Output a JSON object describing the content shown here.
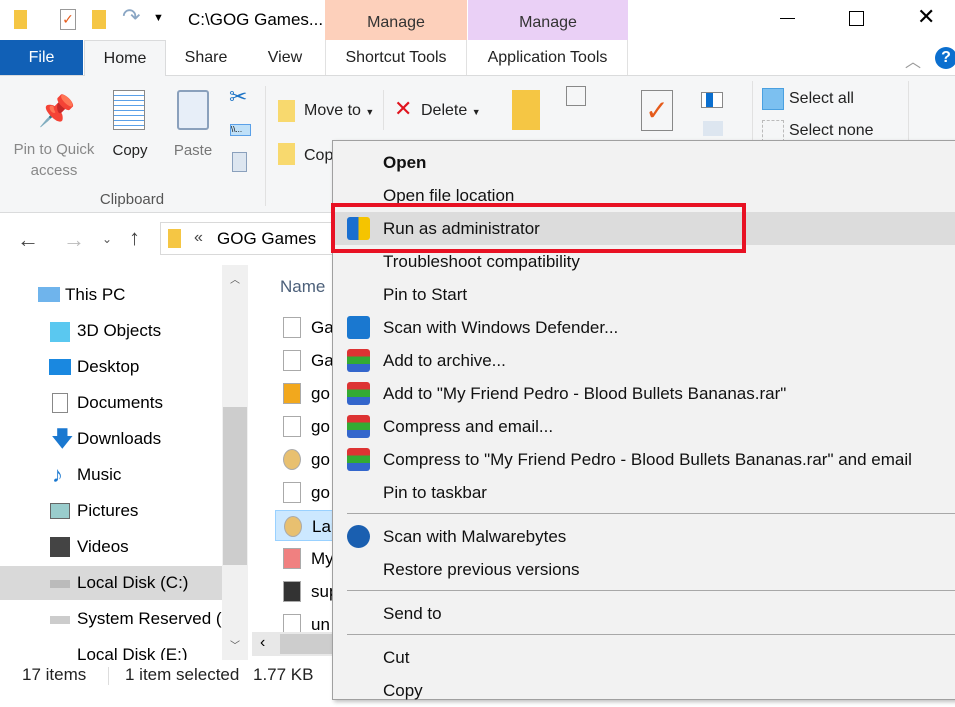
{
  "titlebar": {
    "path": "C:\\GOG Games...",
    "contextual_groups": [
      {
        "label": "Manage",
        "color": "#fdd0bb"
      },
      {
        "label": "Manage",
        "color": "#ead0f6"
      }
    ],
    "controls": [
      "minimize-icon",
      "maximize-icon",
      "close-icon"
    ]
  },
  "tabs": [
    {
      "label": "File"
    },
    {
      "label": "Home"
    },
    {
      "label": "Share"
    },
    {
      "label": "View"
    },
    {
      "label": "Shortcut Tools"
    },
    {
      "label": "Application Tools"
    }
  ],
  "ribbon": {
    "pin": "Pin to Quick",
    "pin2": "access",
    "copy": "Copy",
    "paste": "Paste",
    "clipboard": "Clipboard",
    "move_to": "Move to",
    "delete": "Delete",
    "copy_to": "Copy",
    "select_all": "Select all",
    "select_none": "Select none"
  },
  "address": {
    "crumb_sep": "«",
    "folder": "GOG Games"
  },
  "nav": [
    {
      "label": "This PC"
    },
    {
      "label": "3D Objects"
    },
    {
      "label": "Desktop"
    },
    {
      "label": "Documents"
    },
    {
      "label": "Downloads"
    },
    {
      "label": "Music"
    },
    {
      "label": "Pictures"
    },
    {
      "label": "Videos"
    },
    {
      "label": "Local Disk (C:)"
    },
    {
      "label": "System Reserved ("
    },
    {
      "label": "Local Disk (E:)"
    }
  ],
  "files": {
    "header": "Name",
    "items": [
      {
        "label": "Ga"
      },
      {
        "label": "Ga"
      },
      {
        "label": "go"
      },
      {
        "label": "go"
      },
      {
        "label": "go"
      },
      {
        "label": "go"
      },
      {
        "label": "Lau"
      },
      {
        "label": "My"
      },
      {
        "label": "sup"
      },
      {
        "label": "un"
      }
    ]
  },
  "menu": {
    "items": [
      {
        "label": "Open"
      },
      {
        "label": "Open file location"
      },
      {
        "label": "Run as administrator"
      },
      {
        "label": "Troubleshoot compatibility"
      },
      {
        "label": "Pin to Start"
      },
      {
        "label": "Scan with Windows Defender..."
      },
      {
        "label": "Add to archive..."
      },
      {
        "label": "Add to \"My Friend Pedro - Blood Bullets Bananas.rar\""
      },
      {
        "label": "Compress and email..."
      },
      {
        "label": "Compress to \"My Friend Pedro - Blood Bullets Bananas.rar\" and email"
      },
      {
        "label": "Pin to taskbar"
      },
      {
        "label": "Scan with Malwarebytes"
      },
      {
        "label": "Restore previous versions"
      },
      {
        "label": "Send to"
      },
      {
        "label": "Cut"
      },
      {
        "label": "Copy"
      }
    ],
    "highlight_color": "#e81123"
  },
  "status": {
    "count": "17 items",
    "selected": "1 item selected",
    "size": "1.77 KB"
  },
  "colors": {
    "file_tab": "#1160b6",
    "accent": "#0063b1"
  }
}
